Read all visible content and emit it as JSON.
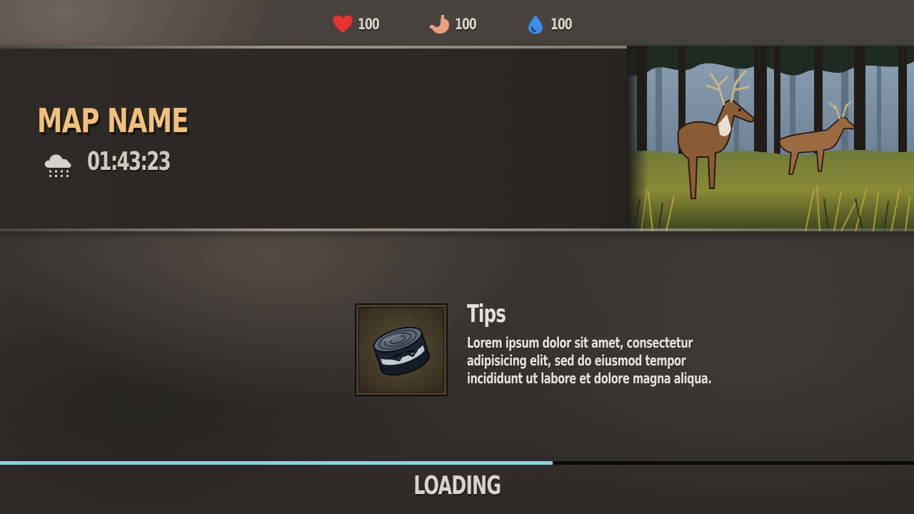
{
  "stats": {
    "health": {
      "icon": "heart-icon",
      "value": "100",
      "color": "#e8322e"
    },
    "hunger": {
      "icon": "stomach-icon",
      "value": "100",
      "color": "#e8a07e"
    },
    "thirst": {
      "icon": "water-drop-icon",
      "value": "100",
      "color": "#3c8ee8"
    }
  },
  "banner": {
    "map_name": "MAP NAME",
    "weather_icon": "snow-cloud-icon",
    "time": "01:43:23",
    "scene_image": "deer-forest-illustration"
  },
  "tips": {
    "item_icon": "tin-can-icon",
    "title": "Tips",
    "body": "Lorem ipsum dolor sit amet, consectetur adipisicing elit, sed do eiusmod tempor incididunt ut labore et dolore magna aliqua."
  },
  "loading": {
    "label": "LOADING",
    "progress": 0.605,
    "fill_color": "#8ed3e0"
  }
}
